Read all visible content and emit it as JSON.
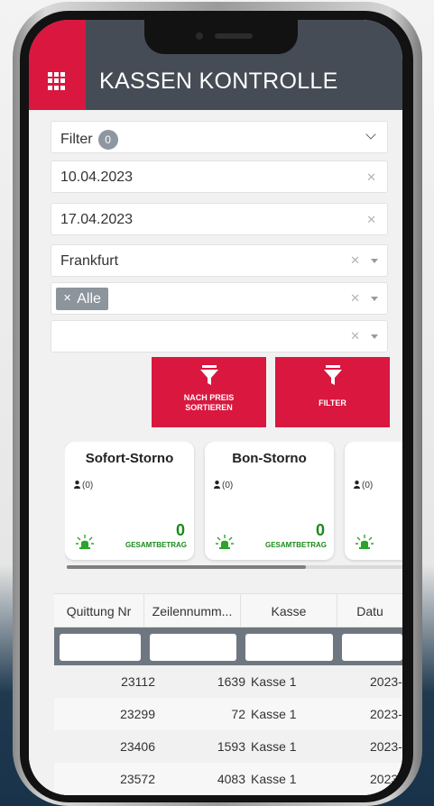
{
  "app": {
    "title": "KASSEN KONTROLLE"
  },
  "filters": {
    "filter_label": "Filter",
    "filter_count": "0",
    "date_from": "10.04.2023",
    "date_to": "17.04.2023",
    "location": "Frankfurt",
    "kasse_tag": "Alle",
    "empty_select": ""
  },
  "buttons": {
    "sort_by_price_line1": "NACH PREIS",
    "sort_by_price_line2": "SORTIEREN",
    "filter": "FILTER"
  },
  "cards": [
    {
      "title": "Sofort-Storno",
      "users": "(0)",
      "total": "0",
      "total_label": "GESAMTBETRAG"
    },
    {
      "title": "Bon-Storno",
      "users": "(0)",
      "total": "0",
      "total_label": "GESAMTBETRAG"
    },
    {
      "title": "",
      "users": "(0)",
      "total": "",
      "total_label": ""
    }
  ],
  "table": {
    "columns": [
      "Quittung Nr",
      "Zeilennumm...",
      "Kasse",
      "Datu"
    ],
    "rows": [
      {
        "quittung": "23112",
        "zeile": "1639",
        "kasse": "Kasse 1",
        "datum": "2023-"
      },
      {
        "quittung": "23299",
        "zeile": "72",
        "kasse": "Kasse 1",
        "datum": "2023-"
      },
      {
        "quittung": "23406",
        "zeile": "1593",
        "kasse": "Kasse 1",
        "datum": "2023-"
      },
      {
        "quittung": "23572",
        "zeile": "4083",
        "kasse": "Kasse 1",
        "datum": "2023-"
      }
    ]
  },
  "colors": {
    "accent": "#d9173f",
    "header": "#454c55",
    "positive": "#1a8a1a"
  },
  "icons": [
    "grid-menu-icon",
    "chevron-down-icon",
    "clear-icon",
    "caret-down-icon",
    "funnel-icon",
    "user-icon",
    "alarm-light-icon"
  ]
}
